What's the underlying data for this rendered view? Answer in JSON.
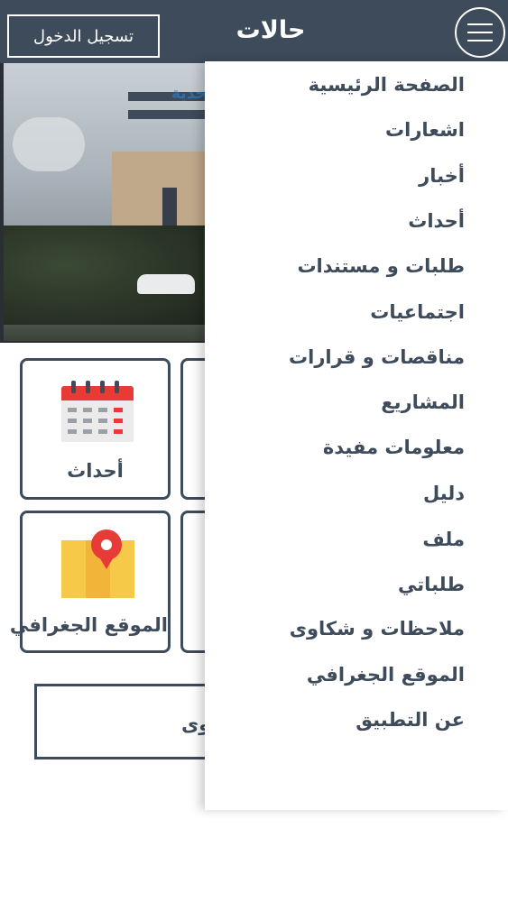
{
  "header": {
    "title": "حالات",
    "login_label": "تسجيل الدخول",
    "menu_icon": "hamburger-icon"
  },
  "banner": {
    "logo_text": "حدية"
  },
  "tiles": {
    "events": {
      "label": "أحداث",
      "icon": "calendar-icon"
    },
    "map": {
      "label": "الموقع الجغرافي",
      "icon": "map-pin-icon"
    },
    "complaints": {
      "label": "شكاوى"
    }
  },
  "drawer": {
    "items": [
      "الصفحة الرئيسية",
      "اشعارات",
      "أخبار",
      "أحداث",
      "طلبات و مستندات",
      "اجتماعيات",
      "مناقصات و قرارات",
      "المشاريع",
      "معلومات مفيدة",
      "دليل",
      "ملف",
      "طلباتي",
      "ملاحظات و شكاوى",
      "الموقع الجغرافي",
      "عن التطبيق"
    ]
  },
  "colors": {
    "primary": "#3d4b5a",
    "accent_red": "#e63b36",
    "map_yellow": "#f7c948",
    "background": "#ffffff"
  }
}
